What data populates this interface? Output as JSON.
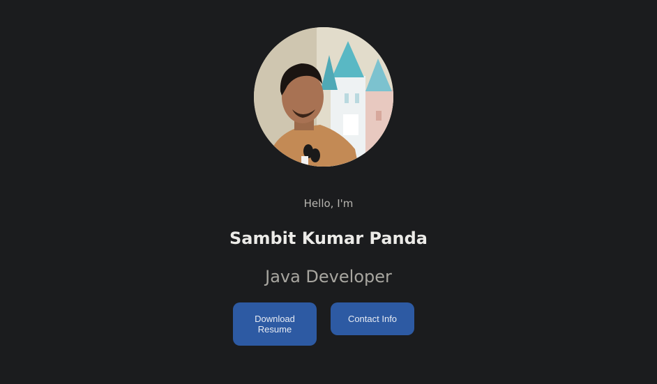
{
  "hero": {
    "greeting": "Hello, I'm",
    "name": "Sambit Kumar Panda",
    "role": "Java Developer"
  },
  "buttons": {
    "download_resume": "Download Resume",
    "contact_info": "Contact Info"
  },
  "colors": {
    "background": "#1b1c1e",
    "button": "#2d5aa3",
    "name_text": "#ecebe8",
    "muted_text": "#a8a6a0"
  },
  "icons": {
    "avatar": "profile-photo"
  }
}
